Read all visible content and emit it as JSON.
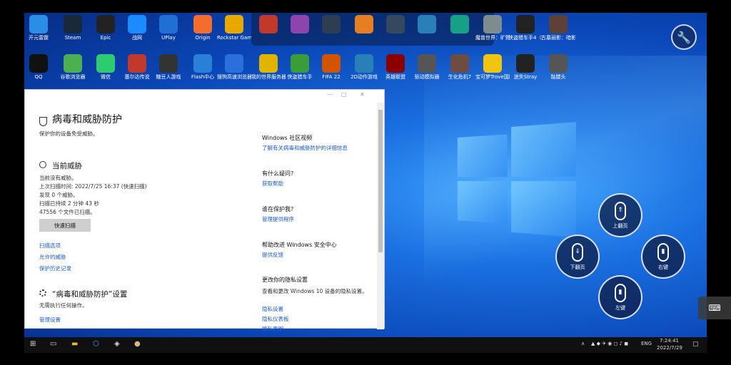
{
  "desktop": {
    "row1": [
      {
        "label": "开元雷霆",
        "icon": "cube-icon",
        "color": "#2a8de6"
      },
      {
        "label": "Steam",
        "icon": "steam-icon",
        "color": "#1b2838"
      },
      {
        "label": "Epic",
        "icon": "epic-icon",
        "color": "#222"
      },
      {
        "label": "战网",
        "icon": "battlenet-icon",
        "color": "#1a8cff"
      },
      {
        "label": "UPlay",
        "icon": "uplay-icon",
        "color": "#1f6fd4"
      },
      {
        "label": "Origin",
        "icon": "origin-icon",
        "color": "#f56c2d"
      },
      {
        "label": "Rockstar Games",
        "icon": "rockstar-icon",
        "color": "#e8a800"
      },
      {
        "label": "",
        "icon": "app-icon",
        "color": "#c0392b"
      },
      {
        "label": "",
        "icon": "app-icon",
        "color": "#8e44ad"
      },
      {
        "label": "",
        "icon": "app-icon",
        "color": "#2c3e50"
      },
      {
        "label": "",
        "icon": "gamepad-icon",
        "color": "#e67e22"
      },
      {
        "label": "",
        "icon": "gamepad-icon",
        "color": "#34495e"
      },
      {
        "label": "",
        "icon": "app-icon",
        "color": "#2980b9"
      },
      {
        "label": "",
        "icon": "app-icon",
        "color": "#16a085"
      },
      {
        "label": "魔兽世界：旷野之息",
        "icon": "game-icon",
        "color": "#7f8c8d"
      },
      {
        "label": "侠盗猎车手4（在线版）",
        "icon": "game-icon",
        "color": "#222"
      },
      {
        "label": "古墓丽影：暗影",
        "icon": "game-icon",
        "color": "#5d4037"
      }
    ],
    "row2": [
      {
        "label": "QQ",
        "icon": "qq-icon",
        "color": "#111"
      },
      {
        "label": "谷歌浏览器",
        "icon": "chrome-icon",
        "color": "#4caf50"
      },
      {
        "label": "微信",
        "icon": "wechat-icon",
        "color": "#2ecc71"
      },
      {
        "label": "塞尔达传说",
        "icon": "game-icon",
        "color": "#c0392b"
      },
      {
        "label": "糖豆人游戏",
        "icon": "game-icon",
        "color": "#333"
      },
      {
        "label": "Flash中心",
        "icon": "flash-icon",
        "color": "#2a7fd6"
      },
      {
        "label": "搜狗高速浏览器",
        "icon": "sogou-icon",
        "color": "#2a6fdb"
      },
      {
        "label": "我的世界服务器",
        "icon": "folder-icon",
        "color": "#e0b400"
      },
      {
        "label": "侠盗猎车手",
        "icon": "gta-icon",
        "color": "#3a9d3a"
      },
      {
        "label": "FIFA 22",
        "icon": "fifa-icon",
        "color": "#d35400"
      },
      {
        "label": "2D动作游戏",
        "icon": "game-icon",
        "color": "#2980b9"
      },
      {
        "label": "英雄联盟",
        "icon": "game-icon",
        "color": "#8b0000"
      },
      {
        "label": "驱动模拟器",
        "icon": "game-icon",
        "color": "#555"
      },
      {
        "label": "生化危机7",
        "icon": "game-icon",
        "color": "#6d4c41"
      },
      {
        "label": "宝可梦Trove国际服",
        "icon": "trove-icon",
        "color": "#f1c40f"
      },
      {
        "label": "迷失Stray",
        "icon": "cat-icon",
        "color": "#222"
      },
      {
        "label": "骷髅头",
        "icon": "skull-icon",
        "color": "#555"
      }
    ]
  },
  "security": {
    "title": "病毒和威胁防护",
    "subtitle": "保护你的设备免受威胁。",
    "current_threats": {
      "heading": "当前威胁",
      "lines": [
        "当前没有威胁。",
        "上次扫描时间: 2022/7/25 16:37 (快速扫描)",
        "发现 0 个威胁。",
        "扫描已持续 2 分钟 43 秒",
        "47556 个文件已扫描。"
      ],
      "scan_button": "快速扫描",
      "links": [
        "扫描选项",
        "允许的威胁",
        "保护历史记录"
      ]
    },
    "settings": {
      "heading": "“病毒和威胁防护”设置",
      "text": "无需执行任何操作。",
      "link": "管理设置"
    },
    "right": [
      {
        "heading": "Windows 社区视频",
        "link": "了解有关病毒和威胁防护的详细信息"
      },
      {
        "heading": "有什么疑问?",
        "link": "获取帮助"
      },
      {
        "heading": "谁在保护我?",
        "link": "管理提供程序"
      },
      {
        "heading": "帮助改进 Windows 安全中心",
        "link": "提供反馈"
      },
      {
        "heading": "更改你的隐私设置",
        "text": "查看和更改 Windows 10 设备的隐私设置。",
        "links": [
          "隐私设置",
          "隐私仪表板",
          "隐私声明"
        ]
      }
    ]
  },
  "controls": {
    "up": "上翻页",
    "down": "下翻页",
    "right": "右键",
    "left": "左键"
  },
  "taskbar": {
    "lang": "ENG",
    "time": "7:24:41",
    "date": "2022/7/29"
  }
}
